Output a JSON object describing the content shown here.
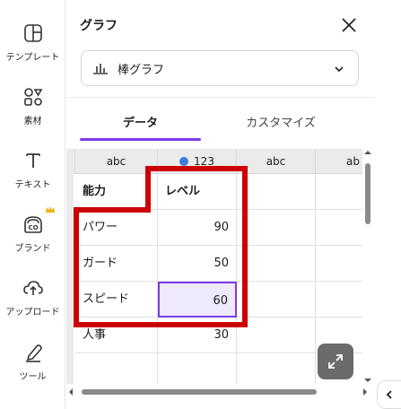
{
  "rail": {
    "items": [
      {
        "label": "テンプレート",
        "icon": "template-icon"
      },
      {
        "label": "素材",
        "icon": "elements-icon"
      },
      {
        "label": "テキスト",
        "icon": "text-icon"
      },
      {
        "label": "ブランド",
        "icon": "brand-icon"
      },
      {
        "label": "アップロード",
        "icon": "upload-icon"
      },
      {
        "label": "ツール",
        "icon": "draw-icon"
      }
    ]
  },
  "panel": {
    "title": "グラフ",
    "chart_type": "棒グラフ",
    "tabs": [
      {
        "label": "データ",
        "active": true
      },
      {
        "label": "カスタマイズ",
        "active": false
      }
    ]
  },
  "table": {
    "column_types": [
      "abc",
      "123",
      "abc",
      "ab"
    ],
    "header": [
      "能力",
      "レベル"
    ],
    "rows": [
      [
        "パワー",
        "90"
      ],
      [
        "ガード",
        "50"
      ],
      [
        "スピード",
        "60"
      ],
      [
        "人事",
        "30"
      ]
    ]
  },
  "colors": {
    "accent": "#7c3aed",
    "annotation": "#cc0000",
    "type_dot": "#3b7ddd"
  }
}
